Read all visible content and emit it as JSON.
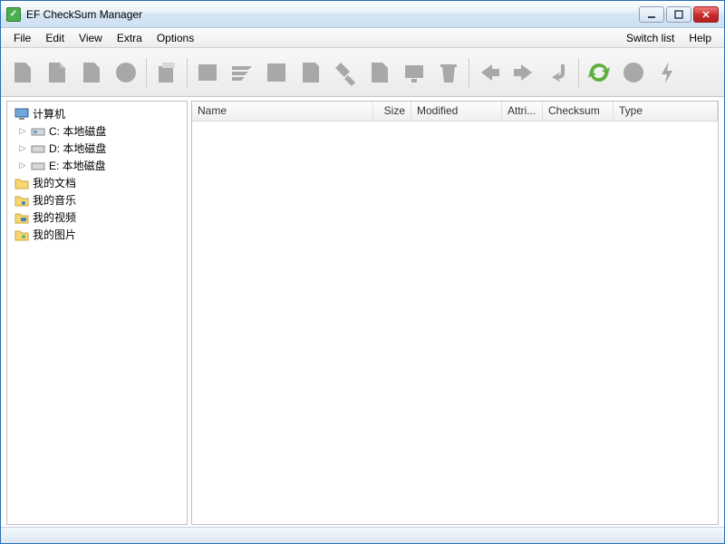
{
  "title": "EF CheckSum Manager",
  "menu": {
    "file": "File",
    "edit": "Edit",
    "view": "View",
    "extra": "Extra",
    "options": "Options",
    "switch_list": "Switch list",
    "help": "Help"
  },
  "toolbar": {
    "icons": [
      "file-new",
      "file-add",
      "file-tag",
      "circle",
      "box-copy",
      "checksum-run",
      "checksum-list",
      "checksum-verify",
      "checksum-write",
      "checksum-repair",
      "checksum-copy",
      "checksum-display",
      "trash",
      "nav-back",
      "nav-forward",
      "nav-return",
      "refresh",
      "record",
      "lightning"
    ]
  },
  "tree": {
    "root": "计算机",
    "drives": [
      {
        "label": "C: 本地磁盘"
      },
      {
        "label": "D: 本地磁盘"
      },
      {
        "label": "E: 本地磁盘"
      }
    ],
    "folders": [
      {
        "label": "我的文档"
      },
      {
        "label": "我的音乐"
      },
      {
        "label": "我的视频"
      },
      {
        "label": "我的图片"
      }
    ]
  },
  "columns": {
    "name": "Name",
    "size": "Size",
    "modified": "Modified",
    "attri": "Attri...",
    "checksum": "Checksum",
    "type": "Type"
  }
}
